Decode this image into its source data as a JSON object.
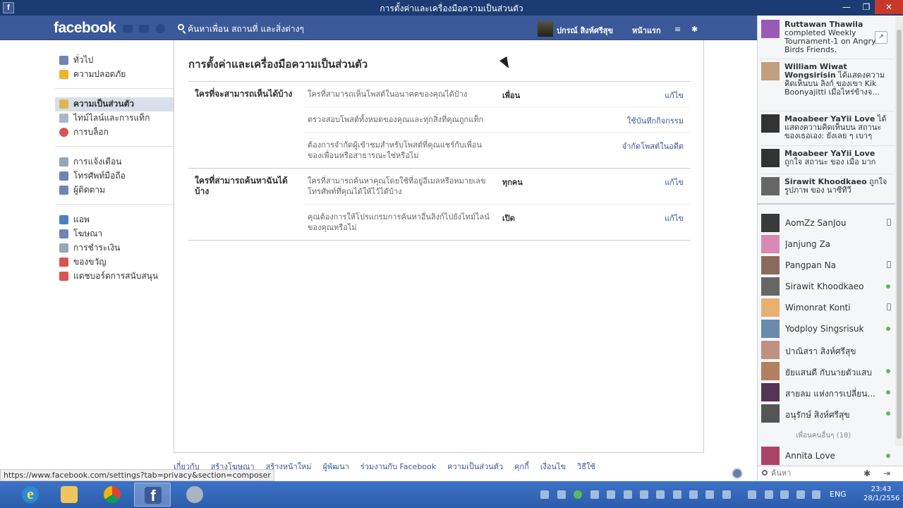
{
  "window": {
    "title": "การตั้งค่าและเครื่องมือความเป็นส่วนตัว",
    "min_glyph": "—",
    "max_glyph": "❐",
    "close_glyph": "✕",
    "app_icon_glyph": "f"
  },
  "header": {
    "logo": "facebook",
    "search_placeholder": "ค้นหาเพื่อน สถานที่ และสิ่งต่างๆ",
    "user_name": "ปกรณ์ สิงห์ศรีสุข",
    "home_label": "หน้าแรก",
    "menu_glyph_1": "≡",
    "menu_glyph_2": "✱"
  },
  "leftnav": {
    "groups": [
      [
        {
          "label": "ทั่วไป",
          "icon": "gear-icon",
          "color": "#6d84b4"
        },
        {
          "label": "ความปลอดภัย",
          "icon": "shield-icon",
          "color": "#f0b429"
        }
      ],
      [
        {
          "label": "ความเป็นส่วนตัว",
          "icon": "lock-icon",
          "color": "#e0b64c",
          "active": true
        },
        {
          "label": "ไทม์ไลน์และการแท็ก",
          "icon": "timeline-icon",
          "color": "#aab6cc"
        },
        {
          "label": "การบล็อก",
          "icon": "block-icon",
          "color": "#d9534f"
        }
      ],
      [
        {
          "label": "การแจ้งเตือน",
          "icon": "notification-icon",
          "color": "#98a4b8"
        },
        {
          "label": "โทรศัพท์มือถือ",
          "icon": "mobile-icon",
          "color": "#6d84b4"
        },
        {
          "label": "ผู้ติดตาม",
          "icon": "rss-icon",
          "color": "#6d84b4"
        }
      ],
      [
        {
          "label": "แอพ",
          "icon": "apps-icon",
          "color": "#4a7fc1"
        },
        {
          "label": "โฆษณา",
          "icon": "ads-icon",
          "color": "#6d84b4"
        },
        {
          "label": "การชำระเงิน",
          "icon": "payment-icon",
          "color": "#98a4b8"
        },
        {
          "label": "ของขวัญ",
          "icon": "gift-icon",
          "color": "#d9534f"
        },
        {
          "label": "แดชบอร์ดการสนับสนุน",
          "icon": "support-icon",
          "color": "#d9534f"
        }
      ]
    ]
  },
  "main": {
    "title": "การตั้งค่าและเครื่องมือความเป็นส่วนตัว",
    "sections": [
      {
        "header": "ใครที่จะสามารถเห็นได้บ้าง",
        "rows": [
          {
            "label": "ใครที่สามารถเห็นโพสต์ในอนาคตของคุณได้บ้าง",
            "value": "เพื่อน",
            "action": "แก้ไข"
          },
          {
            "label": "ตรวจสอบโพสต์ทั้งหมดของคุณและทุกสิ่งที่คุณถูกแท็ก",
            "value": "",
            "action": "ใช้บันทึกกิจกรรม"
          },
          {
            "label": "ต้องการจำกัดผู้เข้าชมสำหรับโพสต์ที่คุณแชร์กับเพื่อนของเพื่อนหรือสาธารณะใช่หรือไม่",
            "value": "",
            "action": "จำกัดโพสต์ในอดีต"
          }
        ]
      },
      {
        "header": "ใครที่สามารถค้นหาฉันได้บ้าง",
        "rows": [
          {
            "label": "ใครที่สามารถค้นหาคุณโดยใช้ที่อยู่อีเมลหรือหมายเลขโทรศัพท์ที่คุณได้ให้ไว้ได้บ้าง",
            "value": "ทุกคน",
            "action": "แก้ไข"
          },
          {
            "label": "คุณต้องการให้โปรแกรมการค้นหาอื่นลิงก์ไปยังไทม์ไลน์ของคุณหรือไม่",
            "value": "เปิด",
            "action": "แก้ไข"
          }
        ]
      }
    ]
  },
  "footer": {
    "links": [
      "เกี่ยวกับ",
      "สร้างโฆษณา",
      "สร้างหน้าใหม่",
      "ผู้พัฒนา",
      "ร่วมงานกับ Facebook",
      "ความเป็นส่วนตัว",
      "คุกกี้",
      "เงื่อนไข",
      "วิธีใช้"
    ]
  },
  "statusbar": {
    "url": "https://www.facebook.com/settings?tab=privacy&section=composer"
  },
  "ticker": [
    {
      "name": "Ruttawan Thawila",
      "text": "completed Weekly Tournament-1 on Angry Birds Friends.",
      "color": "#9b59b6"
    },
    {
      "name": "William Wiwat Wongsirisin",
      "text": "ได้แสดงความคิดเห็นบน ลิงก์ ของเขา Kik Boonyajitti เมื่อไหร่ข้างจ...",
      "color": "#c0a080"
    },
    {
      "name": "Maoabeer YaYii Love",
      "text": "ได้แสดงความคิดเห็นบน สถานะของเธอเอง: ยังเลย ๆ เบาๆ",
      "color": "#333333"
    },
    {
      "name": "Maoabeer YaYii Love",
      "text": "ถูกใจ สถานะ ของ เมื่อ มาก",
      "color": "#333333"
    },
    {
      "name": "Sirawit Khoodkaeo",
      "text": "ถูกใจ รูปภาพ ของ นาซีทีวี",
      "color": "#666666"
    }
  ],
  "popout_glyph": "↗",
  "chat": {
    "friends": [
      {
        "name": "AomZz SanJou",
        "status": "mobile",
        "color": "#3a3a3a"
      },
      {
        "name": "Janjung Za",
        "status": "none",
        "color": "#d88ab0"
      },
      {
        "name": "Pangpan Na",
        "status": "mobile",
        "color": "#8a6a5a"
      },
      {
        "name": "Sirawit Khoodkaeo",
        "status": "online",
        "color": "#666666"
      },
      {
        "name": "Wimonrat Konti",
        "status": "mobile",
        "color": "#e8b070"
      },
      {
        "name": "Yodploy Singsrisuk",
        "status": "online",
        "color": "#6a8ab0"
      },
      {
        "name": "ปาณิสรา สิงห์ศรีสุข",
        "status": "none",
        "color": "#c09080"
      },
      {
        "name": "ยัยแสนดี กับนายตัวแสบ",
        "status": "online",
        "color": "#b08060"
      },
      {
        "name": "สายลม แห่งการเปลี่ยน...",
        "status": "online",
        "color": "#553355"
      },
      {
        "name": "อนุรักษ์ สิงห์ศรีสุข",
        "status": "online",
        "color": "#555555"
      },
      {
        "name": "Annita Love",
        "status": "online",
        "color": "#aa4466"
      }
    ],
    "more_label": "เพื่อนคนอื่นๆ (18)",
    "search_placeholder": "ค้นหา",
    "gear_glyph": "✱",
    "expand_glyph": "⇥"
  },
  "taskbar": {
    "lang": "ENG",
    "time": "23:43",
    "date": "28/1/2556",
    "ie_glyph": "e",
    "fb_glyph": "f"
  }
}
